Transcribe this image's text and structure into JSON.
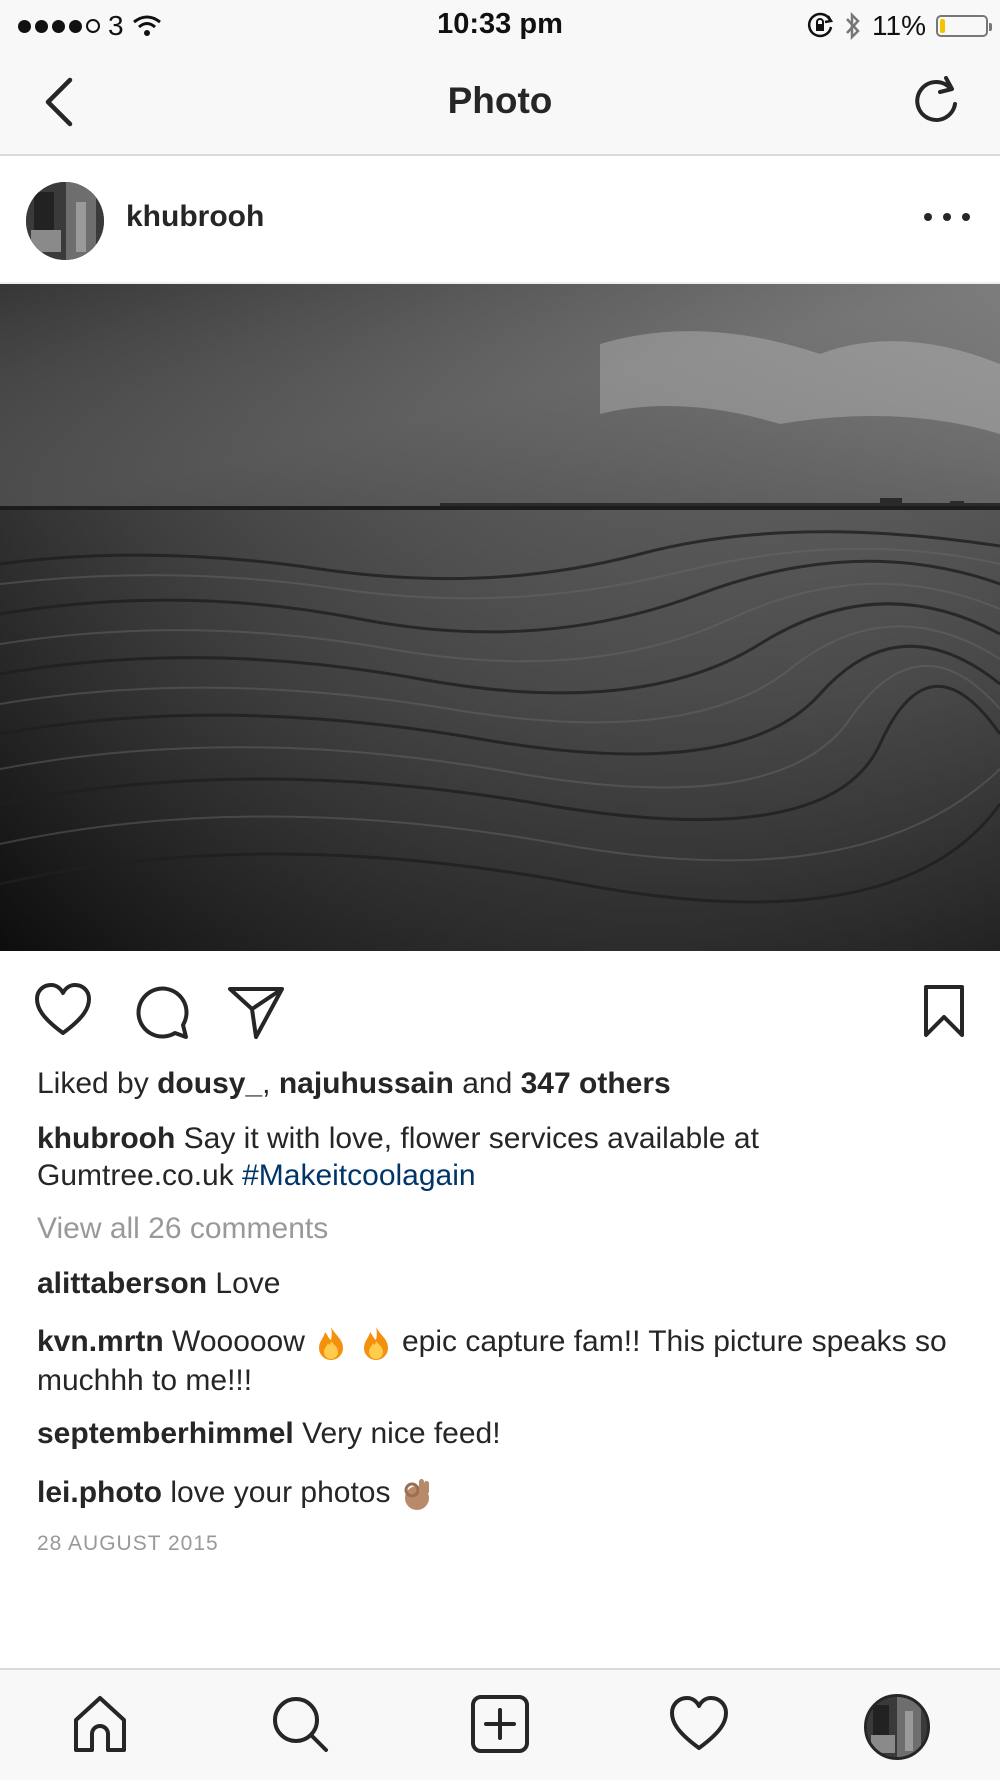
{
  "status_bar": {
    "carrier": "3",
    "time": "10:33 pm",
    "battery_percent": "11%",
    "battery_level": 0.11,
    "signal_bars": 4,
    "icons": [
      "signal-icon",
      "wifi-icon",
      "orientation-lock-icon",
      "bluetooth-icon",
      "battery-icon"
    ]
  },
  "nav": {
    "title": "Photo",
    "back_icon": "chevron-left-icon",
    "refresh_icon": "refresh-icon"
  },
  "post": {
    "username": "khubrooh",
    "more_icon": "more-horizontal-icon",
    "likes": {
      "prefix": "Liked by",
      "user1": "dousy_",
      "separator": ",",
      "user2": "najuhussain",
      "joiner": "and",
      "others": "347 others"
    },
    "caption": {
      "username": "khubrooh",
      "text": "Say it with love, flower services available at Gumtree.co.uk",
      "hashtag": "#Makeitcoolagain"
    },
    "view_all_comments": "View all 26 comments",
    "comments": [
      {
        "username": "alittaberson",
        "text": "Love"
      },
      {
        "username": "kvn.mrtn",
        "text_before": "Wooooow",
        "emoji": "fire-emoji",
        "text_after": "epic capture fam!! This picture speaks so muchhh to me!!!"
      },
      {
        "username": "septemberhimmel",
        "text": "Very nice feed!"
      },
      {
        "username": "lei.photo",
        "text": "love your photos",
        "emoji": "ok-hand-emoji"
      }
    ],
    "date": "28 AUGUST 2015"
  },
  "actions": {
    "icons": [
      "heart-icon",
      "comment-icon",
      "share-icon",
      "bookmark-icon"
    ]
  },
  "tab_bar": {
    "icons": [
      "home-icon",
      "search-icon",
      "add-post-icon",
      "activity-heart-icon",
      "profile-avatar"
    ]
  },
  "colors": {
    "text": "#262626",
    "secondary": "#999999",
    "hashtag": "#003569",
    "bar_background": "#f8f8f8",
    "divider": "#dbdbdb",
    "battery_fill": "#f5c400"
  }
}
